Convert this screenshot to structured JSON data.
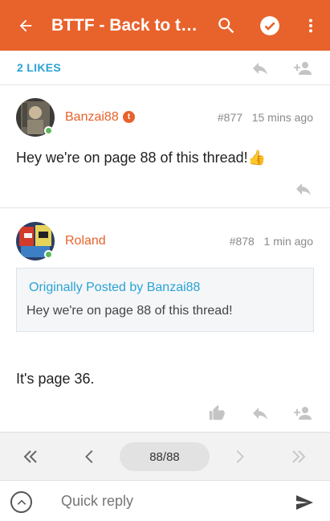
{
  "appbar": {
    "title": "BTTF - Back to the Future",
    "color": "#e8622b",
    "icons": [
      "arrow-back-icon",
      "search-icon",
      "check-circle-icon",
      "more-vert-icon"
    ]
  },
  "likes_row": {
    "label": "2 LIKES"
  },
  "posts": [
    {
      "username": "Banzai88",
      "badge": "t",
      "post_number": "#877",
      "time": "15 mins ago",
      "body": "Hey we're on page 88 of this thread!👍"
    },
    {
      "username": "Roland",
      "post_number": "#878",
      "time": "1 min ago",
      "quote": {
        "header": "Originally Posted by Banzai88",
        "text": "Hey we're on page 88 of this thread!"
      },
      "body": "It's page 36."
    }
  ],
  "pager": {
    "page": "88/88"
  },
  "reply": {
    "placeholder": "Quick reply"
  },
  "colors": {
    "accent": "#e8622b",
    "link": "#2aa3d4",
    "online": "#5cb85c"
  }
}
